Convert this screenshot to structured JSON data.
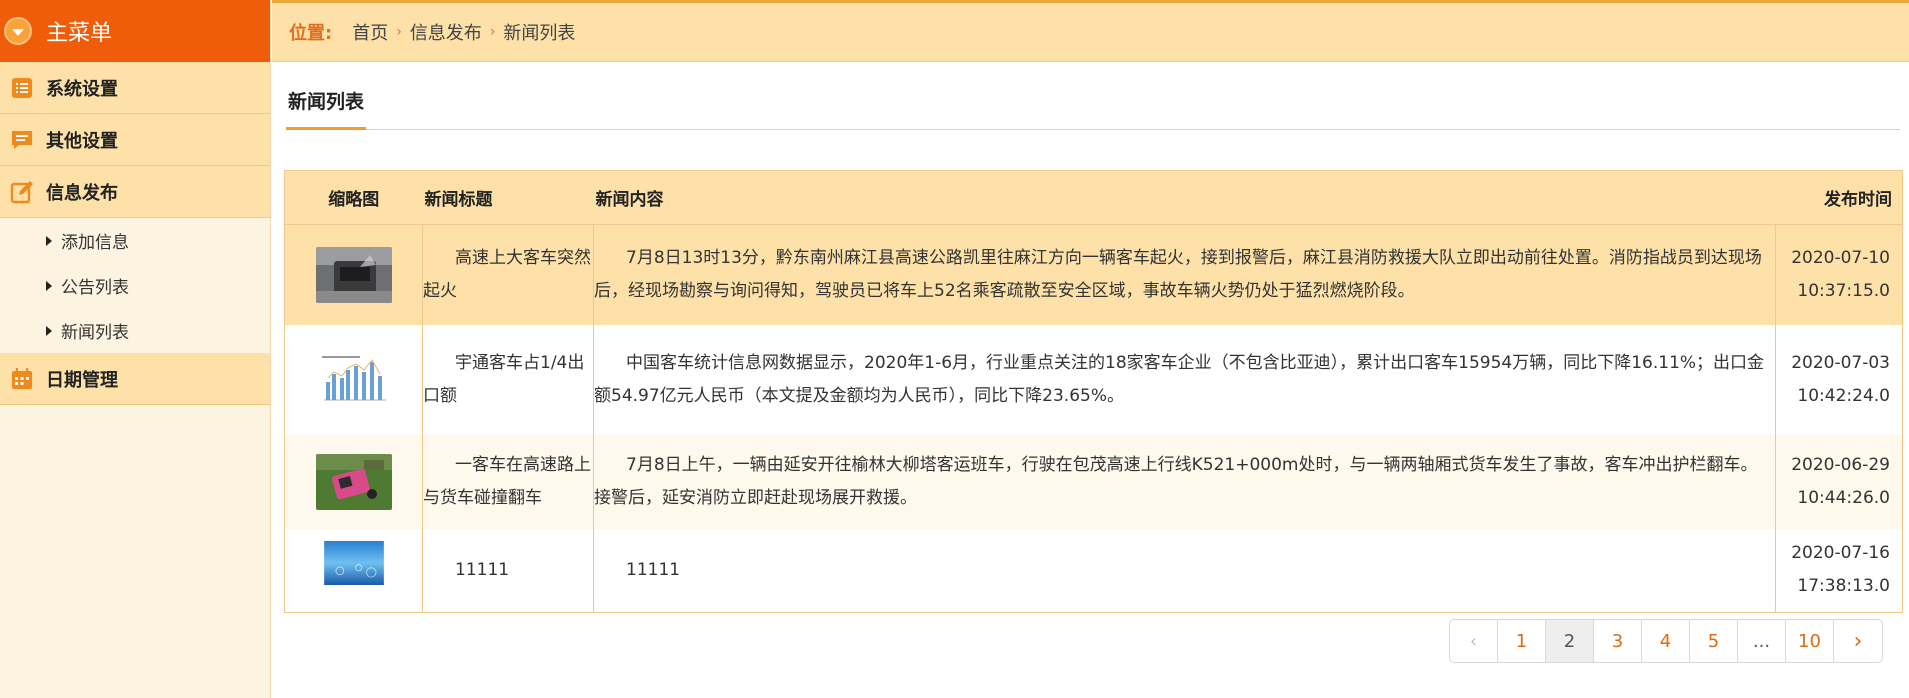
{
  "sidebar": {
    "title": "主菜单",
    "groups": [
      {
        "label": "系统设置"
      },
      {
        "label": "其他设置"
      },
      {
        "label": "信息发布",
        "items": [
          "添加信息",
          "公告列表",
          "新闻列表"
        ]
      },
      {
        "label": "日期管理"
      }
    ]
  },
  "breadcrumb": {
    "prefix": "位置:",
    "items": [
      "首页",
      "信息发布",
      "新闻列表"
    ]
  },
  "page": {
    "title": "新闻列表"
  },
  "table": {
    "headers": [
      "缩略图",
      "新闻标题",
      "新闻内容",
      "发布时间"
    ],
    "rows": [
      {
        "thumb": "bus-fire-photo",
        "title": "高速上大客车突然起火",
        "content": "7月8日13时13分，黔东南州麻江县高速公路凯里往麻江方向一辆客车起火，接到报警后，麻江县消防救援大队立即出动前往处置。消防指战员到达现场后，经现场勘察与询问得知，驾驶员已将车上52名乘客疏散至安全区域，事故车辆火势仍处于猛烈燃烧阶段。",
        "time": "2020-07-10 10:37:15.0"
      },
      {
        "thumb": "bar-chart-photo",
        "title": "宇通客车占1/4出口额",
        "content": "中国客车统计信息网数据显示，2020年1-6月，行业重点关注的18家客车企业（不包含比亚迪），累计出口客车15954万辆，同比下降16.11%；出口金额54.97亿元人民币（本文提及金额均为人民币），同比下降23.65%。",
        "time": "2020-07-03 10:42:24.0"
      },
      {
        "thumb": "overturned-vehicle-photo",
        "title": "一客车在高速路上与货车碰撞翻车",
        "content": "7月8日上午，一辆由延安开往榆林大柳塔客运班车，行驶在包茂高速上行线K521+000m处时，与一辆两轴厢式货车发生了事故，客车冲出护栏翻车。接警后，延安消防立即赶赴现场展开救援。",
        "time": "2020-06-29 10:44:26.0"
      },
      {
        "thumb": "blue-abstract-photo",
        "title": "11111",
        "content": "11111",
        "time": "2020-07-16 17:38:13.0"
      }
    ]
  },
  "pagination": {
    "pages": [
      "1",
      "2",
      "3",
      "4",
      "5",
      "...",
      "10"
    ],
    "current": "2"
  }
}
